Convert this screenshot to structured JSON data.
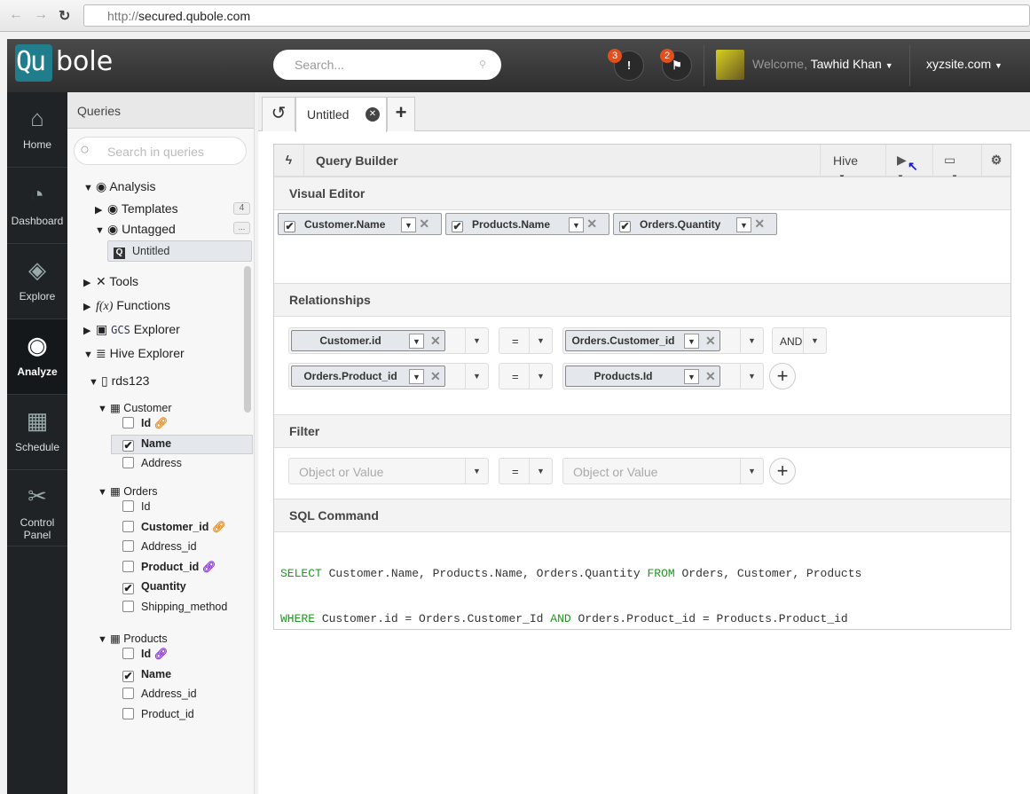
{
  "browser": {
    "url_proto": "http://",
    "url_host": "secured.qubole.com"
  },
  "topbar": {
    "logo_a": "Qu",
    "logo_b": "bole",
    "search_placeholder": "Search...",
    "alerts_count": "3",
    "flags_count": "2",
    "welcome": "Welcome,",
    "user": "Tawhid Khan",
    "site": "xyzsite.com"
  },
  "rail": [
    {
      "label": "Home"
    },
    {
      "label": "Dashboard"
    },
    {
      "label": "Explore"
    },
    {
      "label": "Analyze"
    },
    {
      "label": "Schedule"
    },
    {
      "label": "Control Panel"
    }
  ],
  "sidebar": {
    "title": "Queries",
    "search_placeholder": "Search in queries",
    "analysis": "Analysis",
    "templates": "Templates",
    "templates_count": "4",
    "untagged": "Untagged",
    "untagged_more": "...",
    "untitled": "Untitled",
    "tools": "Tools",
    "functions": "Functions",
    "gcs": "GCS",
    "gcs_explorer": "Explorer",
    "hive": "Hive Explorer",
    "db": "rds123",
    "tables": [
      {
        "name": "Customer",
        "cols": [
          {
            "name": "Id",
            "checked": false,
            "key": "orange"
          },
          {
            "name": "Name",
            "checked": true
          },
          {
            "name": "Address",
            "checked": false
          }
        ]
      },
      {
        "name": "Orders",
        "cols": [
          {
            "name": "Id",
            "checked": false
          },
          {
            "name": "Customer_id",
            "checked": false,
            "key": "orange"
          },
          {
            "name": "Address_id",
            "checked": false
          },
          {
            "name": "Product_id",
            "checked": false,
            "key": "purple"
          },
          {
            "name": "Quantity",
            "checked": true
          },
          {
            "name": "Shipping_method",
            "checked": false
          }
        ]
      },
      {
        "name": "Products",
        "cols": [
          {
            "name": "Id",
            "checked": false,
            "key": "purple"
          },
          {
            "name": "Name",
            "checked": true
          },
          {
            "name": "Address_id",
            "checked": false
          },
          {
            "name": "Product_id",
            "checked": false
          }
        ]
      }
    ]
  },
  "tabs": {
    "active": "Untitled"
  },
  "builder": {
    "title": "Query Builder",
    "engine": "Hive",
    "visual_editor": "Visual Editor",
    "chips": [
      "Customer.Name",
      "Products.Name",
      "Orders.Quantity"
    ],
    "relationships": "Relationships",
    "rel_rows": [
      {
        "left": "Customer.id",
        "op": "=",
        "right": "Orders.Customer_id",
        "conj": "AND"
      },
      {
        "left": "Orders.Product_id",
        "op": "=",
        "right": "Products.Id"
      }
    ],
    "filter": "Filter",
    "filter_left": "Object or Value",
    "filter_op": "=",
    "filter_right": "Object or Value",
    "sql_title": "SQL Command",
    "sql": [
      [
        "SELECT",
        " Customer.Name, Products.Name, Orders.Quantity ",
        "FROM",
        " Orders, Customer, Products"
      ],
      [
        "WHERE",
        " Customer.id = Orders.Customer_Id ",
        "AND",
        " Orders.Product_id = Products.Product_id"
      ]
    ]
  }
}
